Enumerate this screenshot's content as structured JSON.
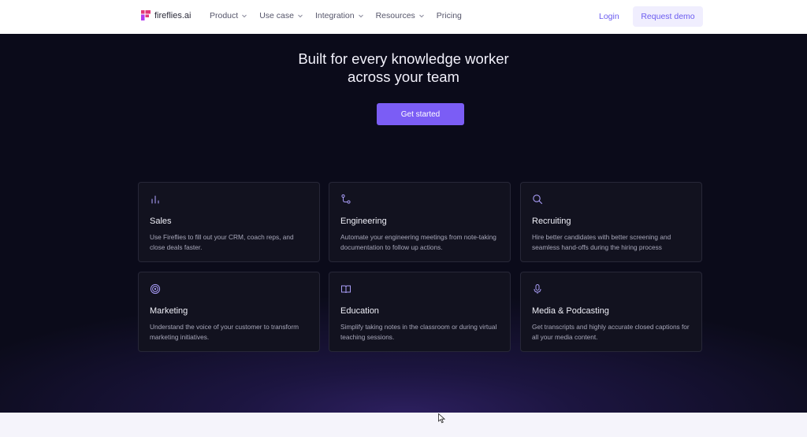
{
  "nav": {
    "logo_text": "fireflies.ai",
    "menu": [
      {
        "label": "Product"
      },
      {
        "label": "Use case"
      },
      {
        "label": "Integration"
      },
      {
        "label": "Resources"
      },
      {
        "label": "Pricing"
      }
    ],
    "login": "Login",
    "request_demo": "Request demo"
  },
  "hero": {
    "headline_line1": "Built for every knowledge worker",
    "headline_line2": "across your team",
    "cta": "Get started"
  },
  "cards": [
    {
      "icon": "bar-chart-icon",
      "title": "Sales",
      "desc": "Use Fireflies to fill out your CRM, coach reps, and close deals faster."
    },
    {
      "icon": "git-branch-icon",
      "title": "Engineering",
      "desc": "Automate your engineering meetings from note-taking documentation to follow up actions."
    },
    {
      "icon": "search-icon",
      "title": "Recruiting",
      "desc": "Hire better candidates with better screening and seamless hand-offs during the hiring process"
    },
    {
      "icon": "target-icon",
      "title": "Marketing",
      "desc": "Understand the voice of your customer to transform marketing initiatives."
    },
    {
      "icon": "book-icon",
      "title": "Education",
      "desc": "Simplify taking notes in the classroom or during virtual teaching sessions."
    },
    {
      "icon": "microphone-icon",
      "title": "Media & Podcasting",
      "desc": "Get transcripts and highly accurate closed captions for all your media content."
    }
  ],
  "colors": {
    "accent": "#7b5df5",
    "hero_bg": "#0b0b1a",
    "link": "#6b5cf0",
    "icon_stroke": "#a89cf6"
  }
}
